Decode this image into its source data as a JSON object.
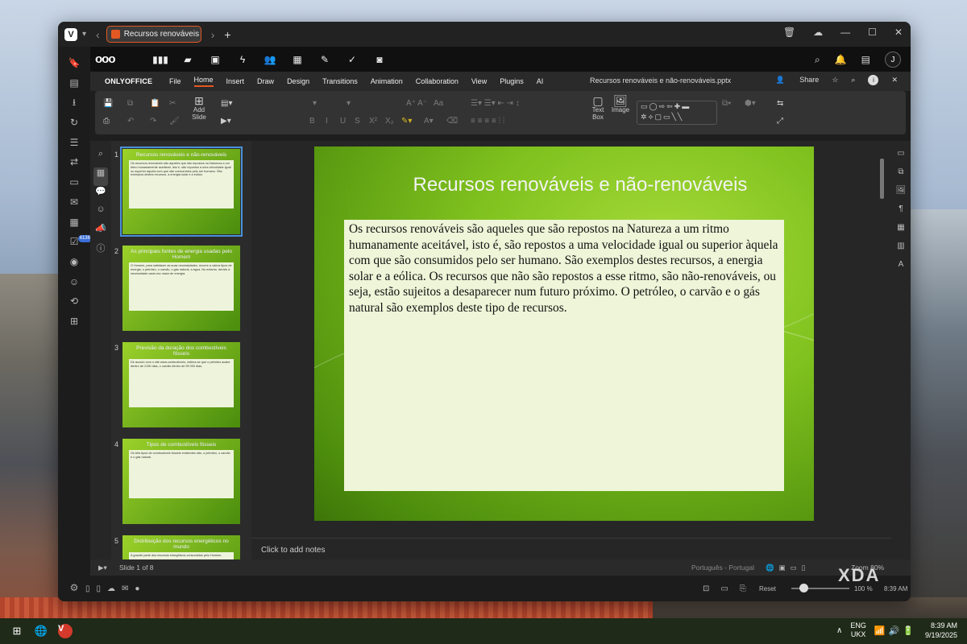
{
  "browser": {
    "tab_title": "Recursos renováveis e não-...",
    "new_tab": "+",
    "window_controls": [
      "🗑",
      "☁",
      "—",
      "☐",
      "✕"
    ]
  },
  "vivaldi_panel": {
    "icons": [
      "bookmark-icon",
      "notes-icon",
      "downloads-icon",
      "history-icon",
      "reading-list-icon",
      "translate-icon",
      "window-icon",
      "mail-icon",
      "calendar-icon",
      "tasks-icon",
      "feed-icon",
      "contacts-icon",
      "web-panel-icon",
      "add-panel-icon"
    ],
    "mail_badge": "6136"
  },
  "nextcloud": {
    "logo": "ooo",
    "apps": [
      "dashboard",
      "files",
      "photos",
      "activity",
      "contacts",
      "calendar",
      "notes",
      "tasks",
      "deck"
    ],
    "avatar_initial": "J"
  },
  "onlyoffice": {
    "brand": "ONLYOFFICE",
    "menus": [
      "File",
      "Home",
      "Insert",
      "Draw",
      "Design",
      "Transitions",
      "Animation",
      "Collaboration",
      "View",
      "Plugins",
      "AI"
    ],
    "active_menu": "Home",
    "document_title": "Recursos renováveis e não-renováveis.pptx",
    "share_label": "Share",
    "info_label": "i"
  },
  "toolbar": {
    "add_slide_label": "Add Slide",
    "text_box_label": "Text Box",
    "image_label": "Image"
  },
  "thumbnails": [
    {
      "num": "1",
      "title": "Recursos renováveis e não-renováveis",
      "body": "Os recursos renováveis são aqueles que são repostos na Natureza a um ritmo humanamente aceitável, isto é, são repostos a uma velocidade igual ou superior àquela com que são consumidos pelo ser humano. São exemplos destes recursos, a energia solar e a eólica."
    },
    {
      "num": "2",
      "title": "As principais fontes de energia usadas pelo Homem",
      "body": "O Homem, para satisfazer as suas necessidades, recorre a vários tipos de energia, o petróleo, o carvão, o gás natural, a água. No entanto, devido à necessidade cada vez maior de energia."
    },
    {
      "num": "3",
      "title": "Previsão da duração dos combustíveis fósseis",
      "body": "De acordo com o site www.combustíveis, estima-se que o petróleo acabe dentro de 2150 dias, o carvão dentro de 95 000 dias."
    },
    {
      "num": "4",
      "title": "Tipos de combustíveis fósseis",
      "body": "Os três tipos de combustíveis fósseis existentes são, o petróleo, o carvão e o gás natural."
    },
    {
      "num": "5",
      "title": "Distribuição dos recursos energéticos no mundo",
      "body": "A grande parte dos recursos energéticos consumidos pelo Homem."
    }
  ],
  "slide": {
    "title": "Recursos renováveis e não-renováveis",
    "body": "Os recursos renováveis são aqueles que são repostos na Natureza a um ritmo humanamente aceitável, isto é, são repostos a uma velocidade igual ou superior àquela com que são consumidos pelo ser humano. São exemplos destes recursos, a energia solar e a eólica.  Os recursos que não são repostos a esse ritmo, são não-renováveis, ou seja, estão sujeitos a desaparecer num futuro próximo. O petróleo, o carvão e o gás natural são exemplos deste tipo de recursos."
  },
  "notes_placeholder": "Click to add notes",
  "statusbar": {
    "slide_info": "Slide 1 of 8",
    "language": "Português - Portugal",
    "zoom_label": "Zoom 80%"
  },
  "vivaldi_status": {
    "reset_label": "Reset",
    "zoom_pct": "100 %",
    "time": "8:39 AM"
  },
  "taskbar": {
    "lang_top": "ENG",
    "lang_bottom": "UKX",
    "time": "8:39 AM",
    "date": "9/19/2025"
  },
  "watermark": "XDA"
}
